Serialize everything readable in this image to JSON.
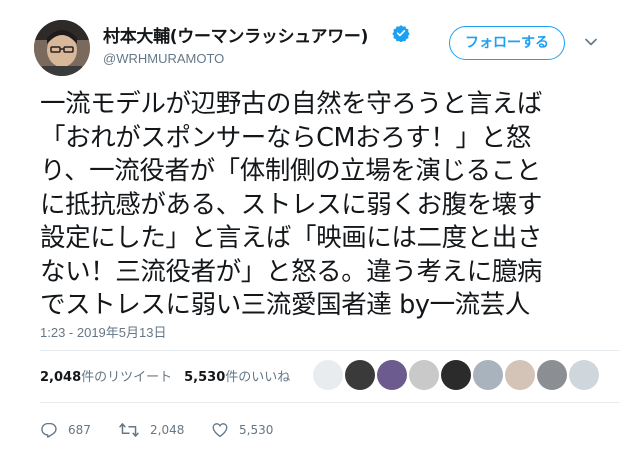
{
  "author": {
    "display_name": "村本大輔(ウーマンラッシュアワー)",
    "handle": "@WRHMURAMOTO",
    "verified": true
  },
  "follow_button_label": "フォローする",
  "tweet": {
    "lines": [
      "一流モデルが辺野古の自然を守ろうと言えば",
      "「おれがスポンサーならCMおろす！」と怒",
      "り、一流役者が「体制側の立場を演じること",
      "に抵抗感がある、ストレスに弱くお腹を壊す",
      "設定にした」と言えば「映画には二度と出さ",
      "ない！三流役者が」と怒る。違う考えに臆病",
      "でストレスに弱い三流愛国者達 by一流芸人"
    ],
    "timestamp": "1:23 - 2019年5月13日"
  },
  "stats": {
    "retweet_count": "2,048",
    "retweet_label": "件のリツイート",
    "like_count": "5,530",
    "like_label": "件のいいね",
    "liker_avatars": 9
  },
  "actions": {
    "reply_count": "687",
    "retweet_count": "2,048",
    "like_count": "5,530"
  },
  "colors": {
    "accent": "#1da1f2",
    "secondary_text": "#657786",
    "divider": "#e6ecf0"
  }
}
